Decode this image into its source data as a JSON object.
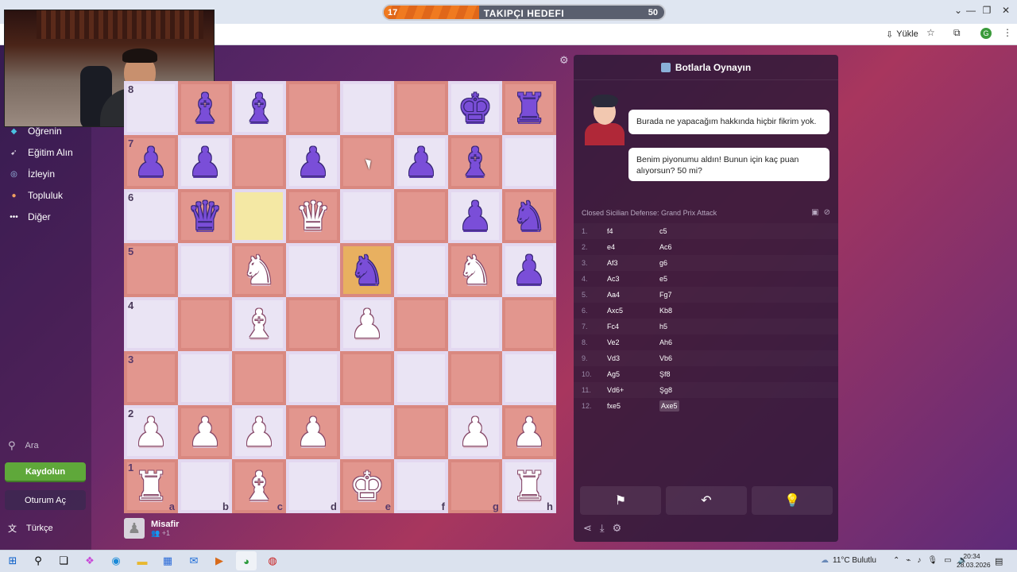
{
  "browser": {
    "install_label": "Yükle",
    "account_initial": "G",
    "win_controls": [
      "⌄",
      "—",
      "❐",
      "✕"
    ]
  },
  "goal_bar": {
    "label": "TAKIPÇI HEDEFI",
    "start": "17",
    "end": "50",
    "progress": 0.34
  },
  "sidebar": {
    "items": [
      {
        "label": "Öğrenin",
        "icon": "learn-icon"
      },
      {
        "label": "Eğitim Alın",
        "icon": "train-icon"
      },
      {
        "label": "İzleyin",
        "icon": "watch-icon"
      },
      {
        "label": "Topluluk",
        "icon": "community-icon"
      },
      {
        "label": "Diğer",
        "icon": "more-icon"
      }
    ],
    "search_label": "Ara",
    "register_label": "Kaydolun",
    "login_label": "Oturum Aç",
    "language_label": "Türkçe"
  },
  "board": {
    "ranks": [
      "8",
      "7",
      "6",
      "5",
      "4",
      "3",
      "2",
      "1"
    ],
    "files": [
      "a",
      "b",
      "c",
      "d",
      "e",
      "f",
      "g",
      "h"
    ],
    "position": [
      [
        "",
        "bB",
        "bB",
        "",
        "",
        "",
        "bK",
        "bR"
      ],
      [
        "bP",
        "bP",
        "",
        "bP",
        "",
        "bP",
        "bB",
        ""
      ],
      [
        "",
        "bQ",
        "",
        "wQ",
        "",
        "",
        "bP",
        "bN"
      ],
      [
        "",
        "",
        "wN",
        "",
        "bN",
        "",
        "wN",
        "bP"
      ],
      [
        "",
        "",
        "wB",
        "",
        "wP",
        "",
        "",
        ""
      ],
      [
        "",
        "",
        "",
        "",
        "",
        "",
        "",
        ""
      ],
      [
        "wP",
        "wP",
        "wP",
        "wP",
        "",
        "",
        "wP",
        "wP"
      ],
      [
        "wR",
        "",
        "wB",
        "",
        "wK",
        "",
        "",
        "wR"
      ]
    ],
    "highlight_squares": [
      "c6",
      "e5"
    ]
  },
  "player": {
    "name": "Misafir",
    "sub": "+1"
  },
  "panel": {
    "title": "Botlarla Oynayın",
    "bubble_1": "Burada ne yapacağım hakkında hiçbir fikrim yok.",
    "bubble_2": "Benim piyonumu aldın! Bunun için kaç puan alıyorsun? 50 mi?",
    "opening": "Closed Sicilian Defense: Grand Prix Attack",
    "moves": [
      {
        "n": "1.",
        "w": "f4",
        "b": "c5"
      },
      {
        "n": "2.",
        "w": "e4",
        "b": "Ac6"
      },
      {
        "n": "3.",
        "w": "Af3",
        "b": "g6"
      },
      {
        "n": "4.",
        "w": "Ac3",
        "b": "e5"
      },
      {
        "n": "5.",
        "w": "Aa4",
        "b": "Fg7"
      },
      {
        "n": "6.",
        "w": "Axc5",
        "b": "Kb8"
      },
      {
        "n": "7.",
        "w": "Fc4",
        "b": "h5"
      },
      {
        "n": "8.",
        "w": "Ve2",
        "b": "Ah6"
      },
      {
        "n": "9.",
        "w": "Vd3",
        "b": "Vb6"
      },
      {
        "n": "10.",
        "w": "Ag5",
        "b": "Şf8"
      },
      {
        "n": "11.",
        "w": "Vd6+",
        "b": "Şg8"
      },
      {
        "n": "12.",
        "w": "fxe5",
        "b": "Axe5"
      }
    ]
  },
  "taskbar": {
    "weather": "11°C Bulutlu",
    "time": "20:34",
    "date": "28.03.2026"
  },
  "colors": {
    "accent_green": "#5fa83a",
    "board_dark": "#e2968e",
    "board_light": "#eae4f4",
    "black_piece": "#7a4ed8"
  }
}
